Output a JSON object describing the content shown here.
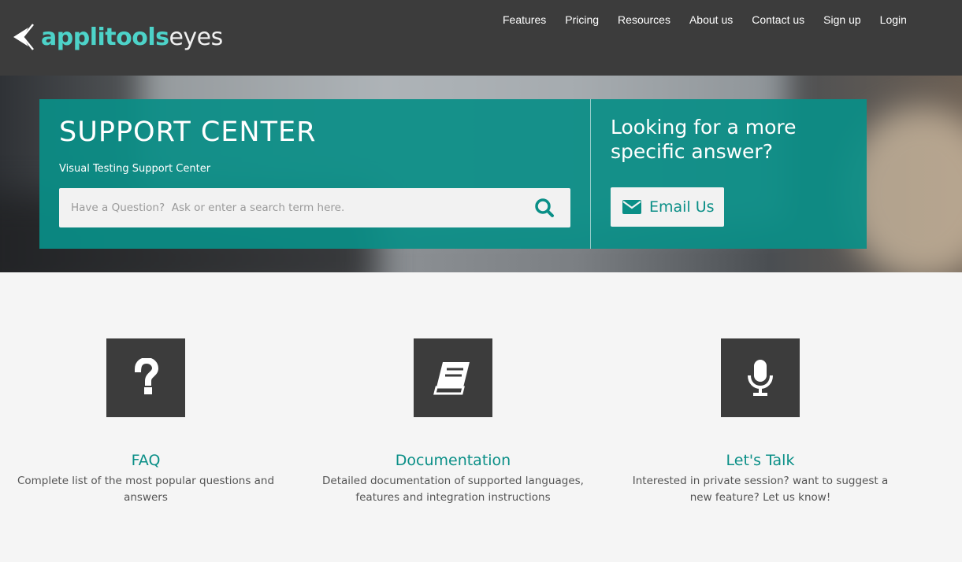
{
  "brand": {
    "name_part1": "applitools",
    "name_part2": "eyes",
    "accent": "#4dd3c9"
  },
  "nav": [
    {
      "label": "Features"
    },
    {
      "label": "Pricing"
    },
    {
      "label": "Resources"
    },
    {
      "label": "About us"
    },
    {
      "label": "Contact us"
    },
    {
      "label": "Sign up"
    },
    {
      "label": "Login"
    }
  ],
  "support": {
    "title": "SUPPORT CENTER",
    "subtitle": "Visual Testing Support Center",
    "search_placeholder": "Have a Question?  Ask or enter a search term here.",
    "search_icon": "search-icon"
  },
  "contact": {
    "heading": "Looking for a more specific answer?",
    "email_label": "Email Us",
    "email_icon": "envelope-icon"
  },
  "cards": [
    {
      "icon": "question-icon",
      "title": "FAQ",
      "desc": "Complete list of the most popular questions and answers"
    },
    {
      "icon": "book-icon",
      "title": "Documentation",
      "desc": "Detailed documentation of supported languages, features and integration instructions"
    },
    {
      "icon": "microphone-icon",
      "title": "Let's Talk",
      "desc": "Interested in private session? want to suggest a new feature? Let us know!"
    }
  ],
  "colors": {
    "header_bg": "#3c3c3c",
    "panel_bg": "#0a8e86",
    "link": "#0a8f87",
    "page_bg": "#f5f5f5"
  }
}
